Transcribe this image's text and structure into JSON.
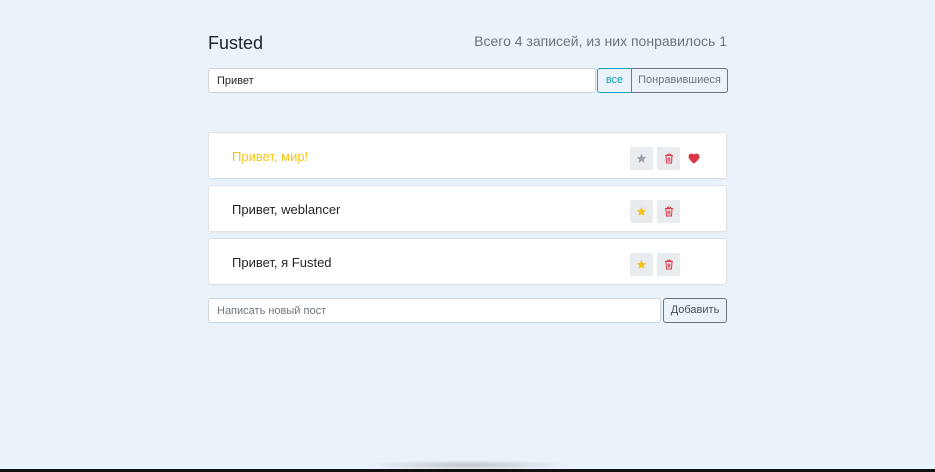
{
  "header": {
    "title": "Fusted",
    "stats": "Всего 4 записей, из них понравилось 1"
  },
  "search": {
    "value": "Привет",
    "placeholder": ""
  },
  "filters": {
    "all_label": "все",
    "liked_label": "Понравившиеся",
    "active": "all"
  },
  "posts": [
    {
      "label": "Привет, мир!",
      "important": true,
      "liked": true
    },
    {
      "label": "Привет, weblancer",
      "important": false,
      "liked": false
    },
    {
      "label": "Привет, я Fusted",
      "important": false,
      "liked": false
    }
  ],
  "add_form": {
    "placeholder": "Написать новый пост",
    "value": "",
    "button_label": "Добавить"
  },
  "colors": {
    "background": "#eaf2fa",
    "important_text": "#f5c518",
    "star_active": "#f5c518",
    "star_inactive": "#9aa0a6",
    "trash": "#dc3545",
    "heart": "#dc3545",
    "filter_active": "#17a2b8",
    "filter_inactive": "#6c757d"
  },
  "icons": {
    "important": "star-icon",
    "delete": "trash-icon",
    "like": "heart-icon"
  }
}
